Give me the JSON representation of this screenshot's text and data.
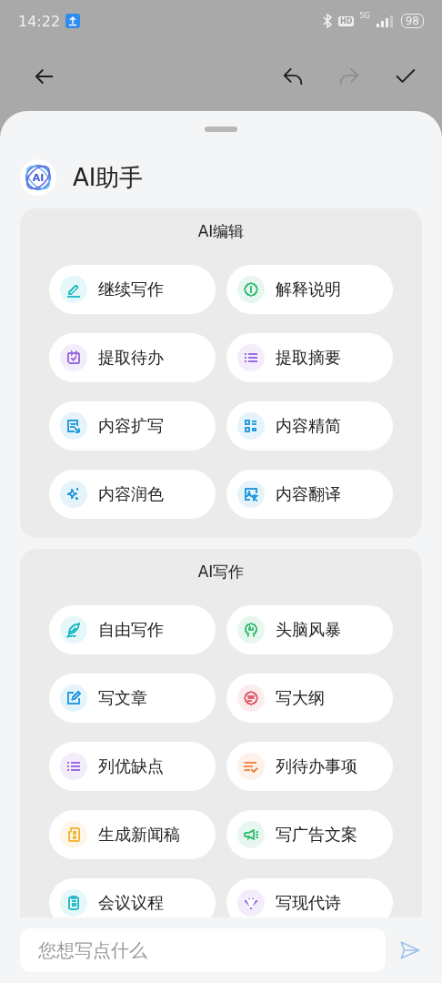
{
  "status_bar": {
    "time": "14:22",
    "hd": "HD",
    "network": "5G",
    "battery": "98"
  },
  "toolbar": {
    "actions": [
      {
        "disabled": false
      },
      {
        "disabled": true
      },
      {
        "disabled": false
      }
    ]
  },
  "assistant": {
    "title": "AI助手",
    "logo": "AI"
  },
  "sections": [
    {
      "title": "AI编辑",
      "items": [
        {
          "label": "继续写作",
          "color": "#2bbcc8"
        },
        {
          "label": "解释说明",
          "color": "#3cbf78"
        },
        {
          "label": "提取待办",
          "color": "#9a6ee0"
        },
        {
          "label": "提取摘要",
          "color": "#9a6ee0"
        },
        {
          "label": "内容扩写",
          "color": "#2a9de0"
        },
        {
          "label": "内容精简",
          "color": "#2a9de0"
        },
        {
          "label": "内容润色",
          "color": "#2a9de0"
        },
        {
          "label": "内容翻译",
          "color": "#2a9de0"
        }
      ]
    },
    {
      "title": "AI写作",
      "items": [
        {
          "label": "自由写作",
          "color": "#2bbcc8"
        },
        {
          "label": "头脑风暴",
          "color": "#3cbf78"
        },
        {
          "label": "写文章",
          "color": "#2a9de0"
        },
        {
          "label": "写大纲",
          "color": "#e0606e"
        },
        {
          "label": "列优缺点",
          "color": "#9a6ee0"
        },
        {
          "label": "列待办事项",
          "color": "#f08a50"
        },
        {
          "label": "生成新闻稿",
          "color": "#f0b840"
        },
        {
          "label": "写广告文案",
          "color": "#3cbf78"
        },
        {
          "label": "会议议程",
          "color": "#2bbcc8"
        },
        {
          "label": "写现代诗",
          "color": "#9a6ee0"
        }
      ]
    }
  ],
  "composer": {
    "placeholder": "您想写点什么"
  }
}
